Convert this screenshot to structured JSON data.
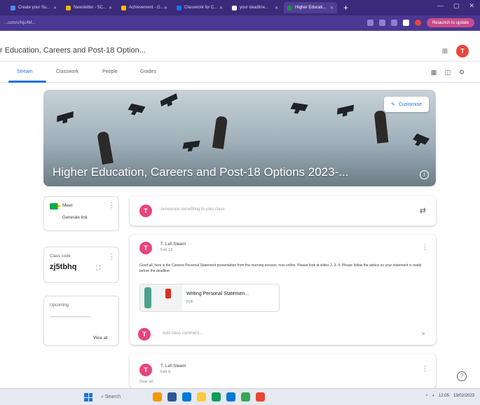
{
  "browser": {
    "tabs": [
      {
        "label": "Create your Su...",
        "icon_color": "#4c8bf5"
      },
      {
        "label": "Newsletter - SC...",
        "icon_color": "#f4b400"
      },
      {
        "label": "Achievement - G...",
        "icon_color": "#fbbc04"
      },
      {
        "label": "Classwork for C...",
        "icon_color": "#1a73e8"
      },
      {
        "label": "your deadline...",
        "icon_color": "#ffffff"
      },
      {
        "label": "Higher Educati...",
        "icon_color": "#1e8e3e"
      }
    ],
    "new_tab": "+",
    "url": "...com/c/Njc4M...",
    "profile_button": "Relaunch to update"
  },
  "header": {
    "class_title": "r Education, Careers and Post-18 Option...",
    "avatar_initial": "T"
  },
  "nav": {
    "tabs": [
      "Stream",
      "Classwork",
      "People",
      "Grades"
    ]
  },
  "banner": {
    "title": "Higher Education, Careers and Post-18 Options 2023-...",
    "customise_label": "Customise"
  },
  "sidebar": {
    "meet": {
      "label": "Meet",
      "link": "Generate link"
    },
    "class_code": {
      "label": "Class code",
      "code": "zj5tbhq"
    },
    "upcoming": {
      "label": "Upcoming",
      "view_all": "View all"
    }
  },
  "stream": {
    "announce_placeholder": "Announce something to your class",
    "posts": [
      {
        "author": "T. Lef-Sleem",
        "date": "Feb 13",
        "body": "Good all, here is the Careers Personal Statement presentation from the morning session, now online. Please look at slides 2, 3, 4. Please follow the advice so your statement is ready before the deadline.",
        "attachment_title": "Writing Personal Statemen...",
        "attachment_type": "PDF"
      },
      {
        "author": "T. Lef-Sleem",
        "date": "Feb 8",
        "body": "Dear all"
      }
    ],
    "comment_placeholder": "Add class comment..."
  },
  "taskbar": {
    "search": "Search",
    "tray_time": "12:05",
    "tray_date": "13/02/2023"
  }
}
